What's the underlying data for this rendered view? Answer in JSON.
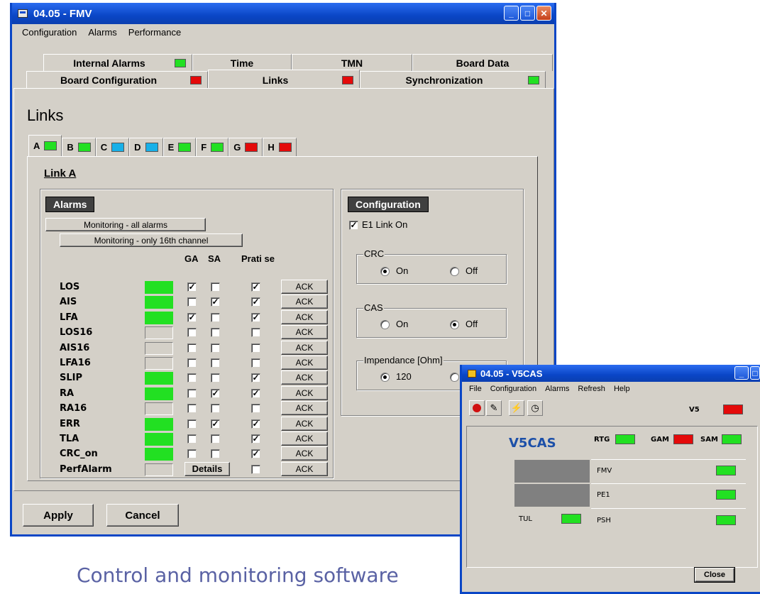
{
  "main_window": {
    "title": "04.05 - FMV",
    "menu": [
      "Configuration",
      "Alarms",
      "Performance"
    ],
    "tabs_row1": [
      {
        "label": "Internal Alarms",
        "led": "green"
      },
      {
        "label": "Time",
        "led": null
      },
      {
        "label": "TMN",
        "led": null
      },
      {
        "label": "Board Data",
        "led": null
      }
    ],
    "tabs_row2": [
      {
        "label": "Board Configuration",
        "led": "red"
      },
      {
        "label": "Links",
        "led": "red",
        "active": true
      },
      {
        "label": "Synchronization",
        "led": "green"
      }
    ],
    "section_title": "Links",
    "link_tabs": [
      {
        "label": "A",
        "led": "green",
        "active": true
      },
      {
        "label": "B",
        "led": "green"
      },
      {
        "label": "C",
        "led": "cyan"
      },
      {
        "label": "D",
        "led": "cyan"
      },
      {
        "label": "E",
        "led": "green"
      },
      {
        "label": "F",
        "led": "green"
      },
      {
        "label": "G",
        "led": "red"
      },
      {
        "label": "H",
        "led": "red"
      }
    ],
    "link_heading": "Link A",
    "alarms": {
      "title": "Alarms",
      "monitor_all": "Monitoring - all alarms",
      "monitor_16": "Monitoring - only 16th channel",
      "col_ga": "GA",
      "col_sa": "SA",
      "col_prati": "Prati se",
      "ack_label": "ACK",
      "details_label": "Details",
      "rows": [
        {
          "name": "LOS",
          "status": true,
          "ga": true,
          "sa": false,
          "prati": true
        },
        {
          "name": "AIS",
          "status": true,
          "ga": false,
          "sa": true,
          "prati": true
        },
        {
          "name": "LFA",
          "status": true,
          "ga": true,
          "sa": false,
          "prati": true
        },
        {
          "name": "LOS16",
          "status": false,
          "ga": false,
          "sa": false,
          "prati": false
        },
        {
          "name": "AIS16",
          "status": false,
          "ga": false,
          "sa": false,
          "prati": false
        },
        {
          "name": "LFA16",
          "status": false,
          "ga": false,
          "sa": false,
          "prati": false
        },
        {
          "name": "SLIP",
          "status": true,
          "ga": false,
          "sa": false,
          "prati": true
        },
        {
          "name": "RA",
          "status": true,
          "ga": false,
          "sa": true,
          "prati": true
        },
        {
          "name": "RA16",
          "status": false,
          "ga": false,
          "sa": false,
          "prati": false
        },
        {
          "name": "ERR",
          "status": true,
          "ga": false,
          "sa": true,
          "prati": true
        },
        {
          "name": "TLA",
          "status": true,
          "ga": false,
          "sa": false,
          "prati": true
        },
        {
          "name": "CRC_on",
          "status": true,
          "ga": false,
          "sa": false,
          "prati": true
        },
        {
          "name": "PerfAlarm",
          "status": false,
          "ga": null,
          "sa": null,
          "prati": false,
          "details": true
        }
      ]
    },
    "configuration": {
      "title": "Configuration",
      "e1_link_on": "E1 Link On",
      "e1_checked": true,
      "crc": {
        "legend": "CRC",
        "on": "On",
        "off": "Off",
        "selected": "On"
      },
      "cas": {
        "legend": "CAS",
        "on": "On",
        "off": "Off",
        "selected": "Off"
      },
      "impedance": {
        "legend": "Impendance [Ohm]",
        "value": "120"
      }
    },
    "apply": "Apply",
    "cancel": "Cancel"
  },
  "caption": "Control and monitoring software",
  "v5_window": {
    "title": "04.05 - V5CAS",
    "menu": [
      "File",
      "Configuration",
      "Alarms",
      "Refresh",
      "Help"
    ],
    "v5_label": "V5",
    "heading": "V5CAS",
    "rtg": "RTG",
    "gam": "GAM",
    "sam": "SAM",
    "rows": [
      "FMV",
      "PE1",
      "PSH"
    ],
    "tul": "TUL",
    "close": "Close"
  },
  "colors": {
    "green": "#22e022",
    "red": "#e40a0a",
    "cyan": "#18b0e8",
    "title_blue": "#0a46c6"
  }
}
